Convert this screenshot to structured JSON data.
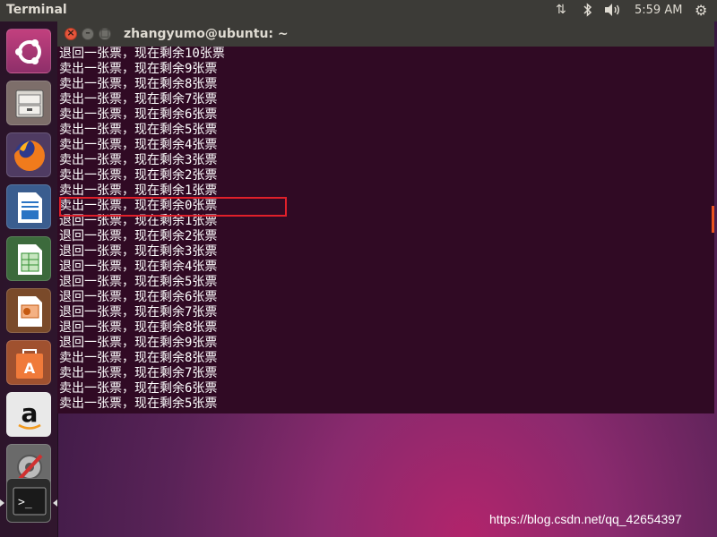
{
  "topbar": {
    "app_title": "Terminal",
    "clock": "5:59 AM",
    "icons": [
      "network-arrows-icon",
      "bluetooth-icon",
      "volume-icon",
      "settings-gear-icon"
    ]
  },
  "launcher": {
    "items": [
      {
        "name": "ubuntu-dash"
      },
      {
        "name": "files"
      },
      {
        "name": "firefox"
      },
      {
        "name": "libreoffice-writer"
      },
      {
        "name": "libreoffice-calc"
      },
      {
        "name": "libreoffice-impress"
      },
      {
        "name": "ubuntu-software"
      },
      {
        "name": "amazon",
        "glyph": "a"
      },
      {
        "name": "system-settings"
      },
      {
        "name": "terminal",
        "glyph": ">_"
      }
    ]
  },
  "window": {
    "title": "zhangyumo@ubuntu: ~"
  },
  "terminal_lines": [
    "退回一张票，现在剩余10张票",
    "卖出一张票，现在剩余9张票",
    "卖出一张票，现在剩余8张票",
    "卖出一张票，现在剩余7张票",
    "卖出一张票，现在剩余6张票",
    "卖出一张票，现在剩余5张票",
    "卖出一张票，现在剩余4张票",
    "卖出一张票，现在剩余3张票",
    "卖出一张票，现在剩余2张票",
    "卖出一张票，现在剩余1张票",
    "卖出一张票，现在剩余0张票",
    "退回一张票，现在剩余1张票",
    "退回一张票，现在剩余2张票",
    "退回一张票，现在剩余3张票",
    "退回一张票，现在剩余4张票",
    "退回一张票，现在剩余5张票",
    "退回一张票，现在剩余6张票",
    "退回一张票，现在剩余7张票",
    "退回一张票，现在剩余8张票",
    "退回一张票，现在剩余9张票",
    "卖出一张票，现在剩余8张票",
    "卖出一张票，现在剩余7张票",
    "卖出一张票，现在剩余6张票",
    "卖出一张票，现在剩余5张票"
  ],
  "highlighted_line_index": 10,
  "watermark": "https://blog.csdn.net/qq_42654397",
  "colors": {
    "terminal_bg": "#300a24",
    "highlight": "#e0202a",
    "close_button": "#e6553b"
  }
}
